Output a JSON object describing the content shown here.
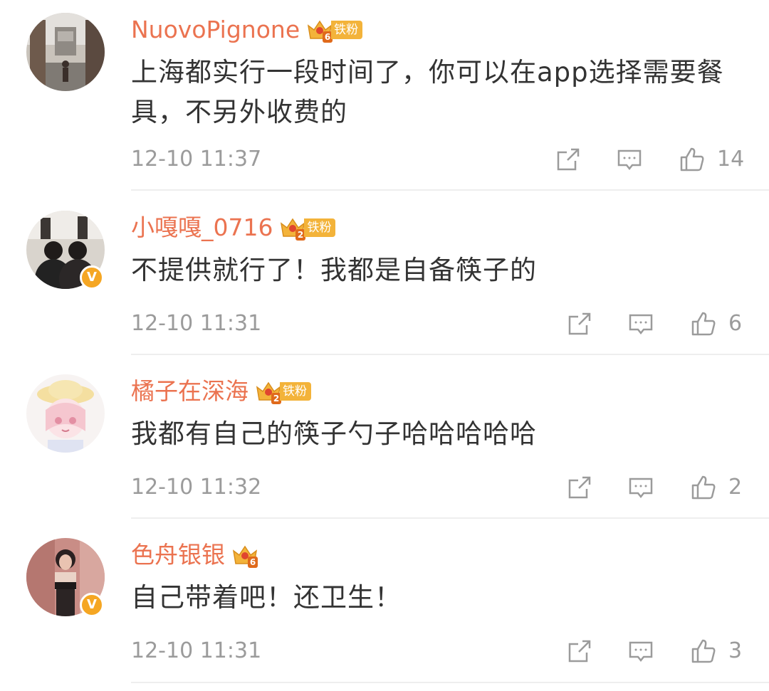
{
  "comments": [
    {
      "username": "NuovoPignone",
      "fan_level": "6",
      "fan_badge": "铁粉",
      "verified": false,
      "text": "上海都实行一段时间了，你可以在app选择需要餐具，不另外收费的",
      "time": "12-10 11:37",
      "likes": "14"
    },
    {
      "username": "小嘎嘎_0716",
      "fan_level": "2",
      "fan_badge": "铁粉",
      "verified": true,
      "text": "不提供就行了！我都是自备筷子的",
      "time": "12-10 11:31",
      "likes": "6"
    },
    {
      "username": "橘子在深海",
      "fan_level": "2",
      "fan_badge": "铁粉",
      "verified": false,
      "text": "我都有自己的筷子勺子哈哈哈哈哈",
      "time": "12-10 11:32",
      "likes": "2"
    },
    {
      "username": "色舟银银",
      "fan_level": "6",
      "fan_badge": "",
      "verified": true,
      "text": "自己带着吧！还卫生！",
      "time": "12-10 11:31",
      "likes": "3"
    }
  ],
  "verified_mark": "V",
  "colors": {
    "username": "#eb7350",
    "text": "#333333",
    "meta": "#9b9b9b",
    "badge": "#f3b33a",
    "verified": "#f5a623"
  },
  "icons": {
    "share": "share-icon",
    "comment": "comment-icon",
    "like": "thumbs-up-icon",
    "crown": "crown-icon",
    "verified": "verified-v-icon"
  }
}
